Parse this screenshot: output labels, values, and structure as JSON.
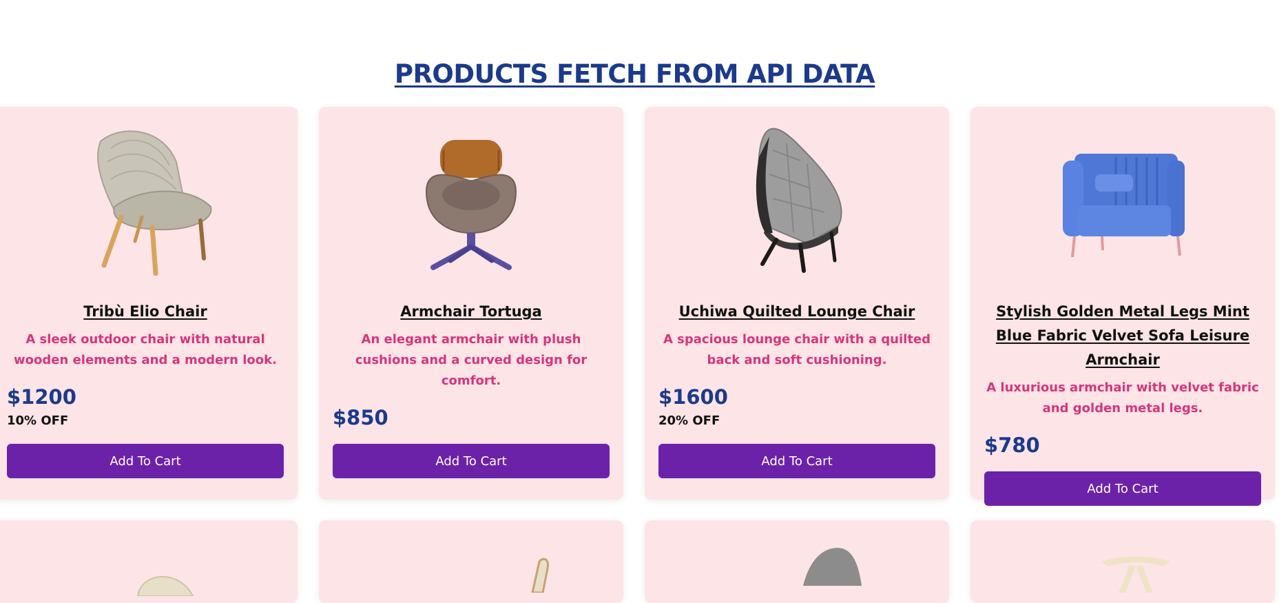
{
  "page": {
    "title": "PRODUCTS FETCH FROM API DATA"
  },
  "colors": {
    "title": "#1b3a8c",
    "card_bg": "#fde4e6",
    "description": "#d6357b",
    "price": "#1b3a8c",
    "button_bg": "#6c22a8"
  },
  "products": [
    {
      "name": "Tribù Elio Chair",
      "description": "A sleek outdoor chair with natural wooden elements and a modern look.",
      "price": "$1200",
      "discount": "10% OFF",
      "button_label": "Add To Cart",
      "image_icon": "woven-lounge-chair-image"
    },
    {
      "name": "Armchair Tortuga",
      "description": "An elegant armchair with plush cushions and a curved design for comfort.",
      "price": "$850",
      "discount": "",
      "button_label": "Add To Cart",
      "image_icon": "swivel-armchair-image"
    },
    {
      "name": "Uchiwa Quilted Lounge Chair",
      "description": "A spacious lounge chair with a quilted back and soft cushioning.",
      "price": "$1600",
      "discount": "20% OFF",
      "button_label": "Add To Cart",
      "image_icon": "quilted-lounge-chair-image"
    },
    {
      "name": "Stylish Golden Metal Legs Mint Blue Fabric Velvet Sofa Leisure Armchair",
      "description": "A luxurious armchair with velvet fabric and golden metal legs.",
      "price": "$780",
      "discount": "",
      "button_label": "Add To Cart",
      "image_icon": "velvet-armchair-image"
    }
  ]
}
